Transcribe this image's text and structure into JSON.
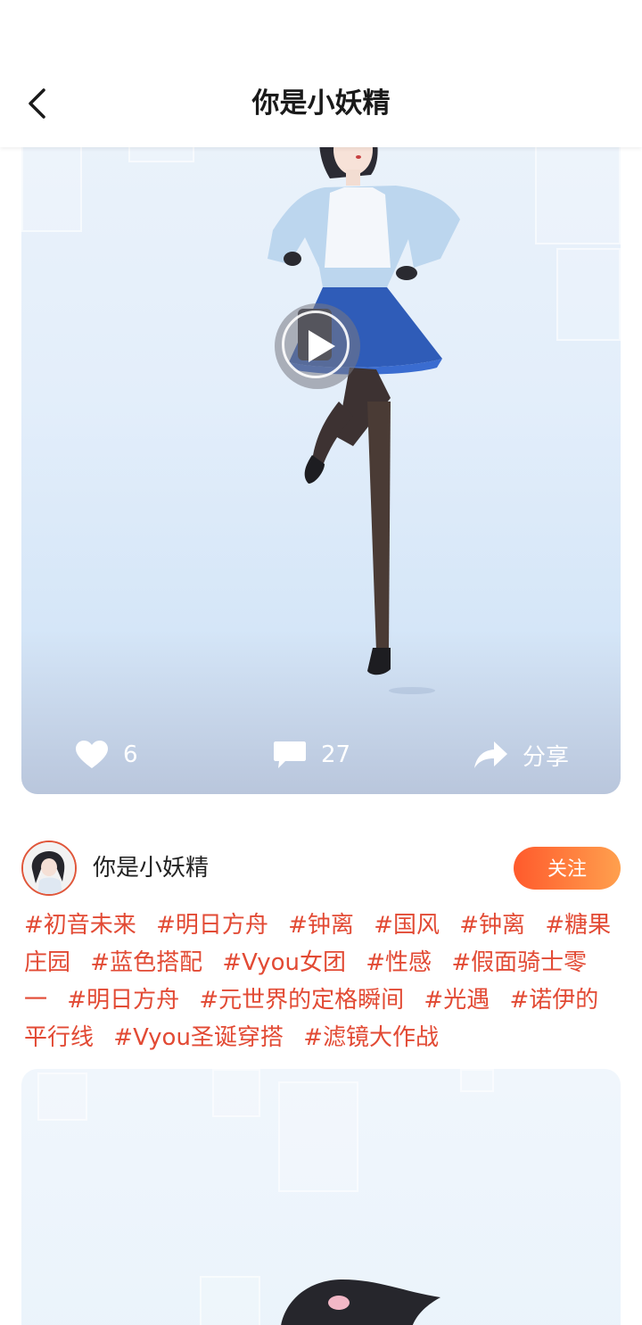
{
  "header": {
    "title": "你是小妖精"
  },
  "post": {
    "likes": "6",
    "comments": "27",
    "share_label": "分享"
  },
  "author": {
    "name": "你是小妖精",
    "follow_label": "关注"
  },
  "tags": [
    "#初音未来",
    "#明日方舟",
    "#钟离",
    "#国风",
    "#钟离",
    "#糖果庄园",
    "#蓝色搭配",
    "#Vyou女团",
    "#性感",
    "#假面骑士零一",
    "#明日方舟",
    "#元世界的定格瞬间",
    "#光遇",
    "#诺伊的平行线",
    "#Vyou圣诞穿搭",
    "#滤镜大作战"
  ],
  "colors": {
    "accent_text": "#e24a34",
    "follow_gradient_start": "#ff5a2c",
    "follow_gradient_end": "#ffa04e"
  },
  "icons": {
    "back": "chevron-left-icon",
    "play": "play-icon",
    "like": "heart-icon",
    "comment": "comment-icon",
    "share": "share-arrow-icon"
  }
}
